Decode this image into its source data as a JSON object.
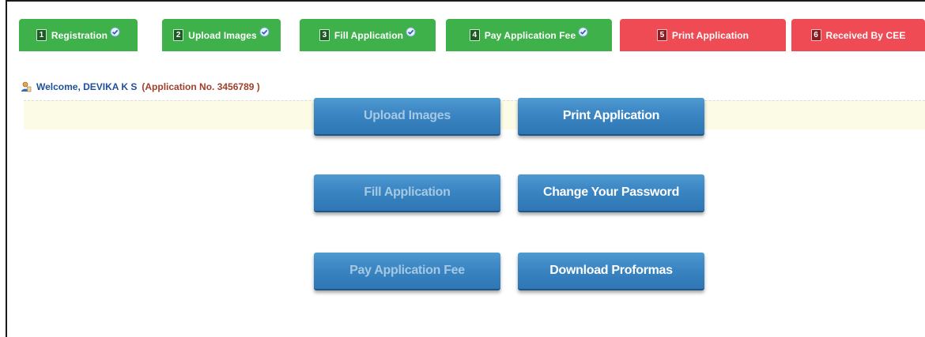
{
  "steps": [
    {
      "num": "1",
      "label": "Registration",
      "status": "done",
      "checked": true
    },
    {
      "num": "2",
      "label": "Upload Images",
      "status": "done",
      "checked": true
    },
    {
      "num": "3",
      "label": "Fill Application",
      "status": "done",
      "checked": true
    },
    {
      "num": "4",
      "label": "Pay Application Fee",
      "status": "done",
      "checked": true
    },
    {
      "num": "5",
      "label": "Print Application",
      "status": "pending",
      "checked": false
    },
    {
      "num": "6",
      "label": "Received By CEE",
      "status": "pending",
      "checked": false
    }
  ],
  "welcome": {
    "text": "Welcome, DEVIKA K S",
    "application": "(Application No.  3456789 )"
  },
  "actions": {
    "upload_images": {
      "label": "Upload Images",
      "enabled": false
    },
    "print_application": {
      "label": "Print Application",
      "enabled": true
    },
    "fill_application": {
      "label": "Fill Application",
      "enabled": false
    },
    "change_password": {
      "label": "Change Your Password",
      "enabled": true
    },
    "pay_fee": {
      "label": "Pay Application Fee",
      "enabled": false
    },
    "download_proformas": {
      "label": "Download Proformas",
      "enabled": true
    }
  },
  "colors": {
    "step_done": "#3fb14b",
    "step_pending": "#ef4b55",
    "button": "#3a85c3",
    "welcome_text": "#1f4f9a",
    "application_text": "#a0402c"
  }
}
